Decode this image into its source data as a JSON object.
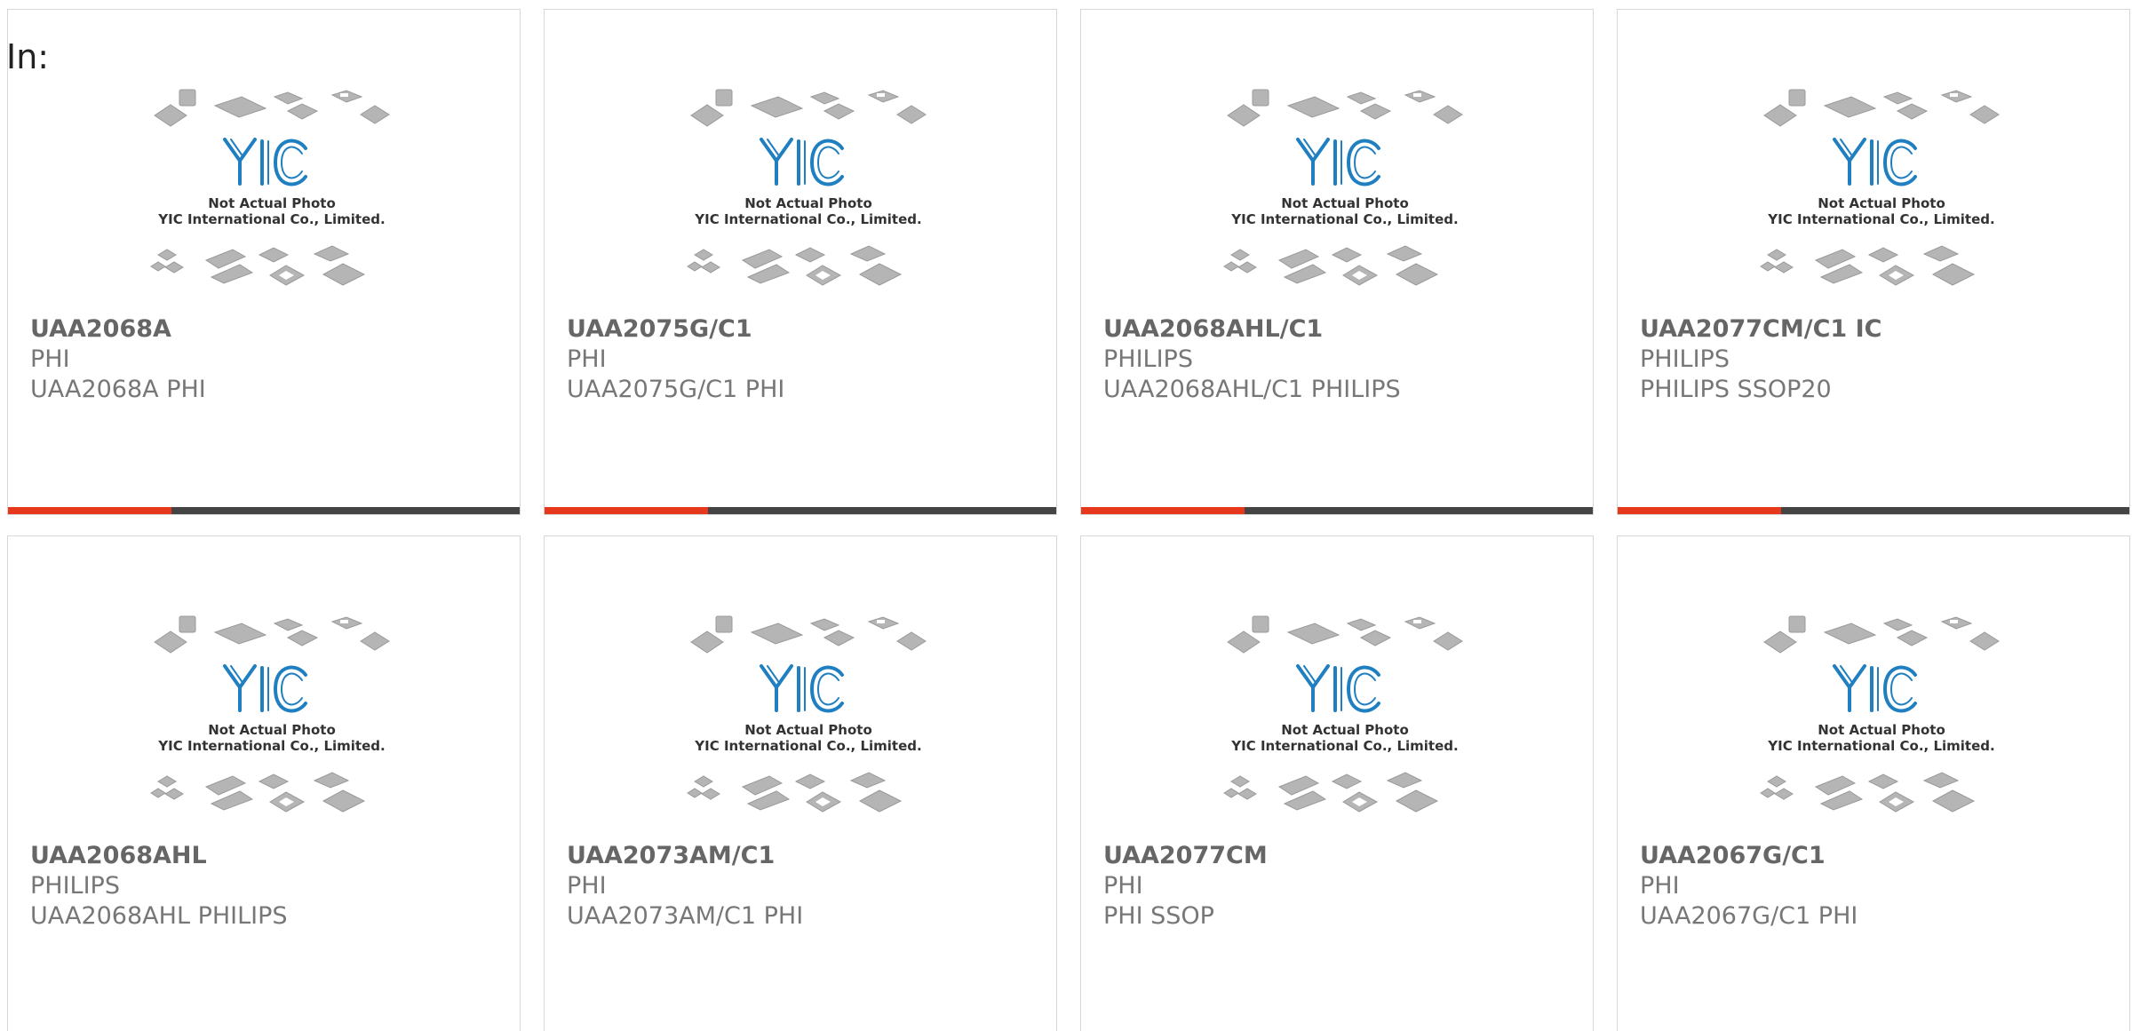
{
  "header": {
    "in_label": "In:"
  },
  "placeholder": {
    "line1": "Not Actual Photo",
    "line2": "YIC International Co., Limited.",
    "logo": "YIC"
  },
  "colors": {
    "accent": "#e8381b",
    "bar": "#444444",
    "logo_blue": "#1f7fc0"
  },
  "products": [
    {
      "part": "UAA2068A",
      "brand": "PHI",
      "desc": "UAA2068A PHI",
      "bar_accent_fraction": 0.32
    },
    {
      "part": "UAA2075G/C1",
      "brand": "PHI",
      "desc": "UAA2075G/C1 PHI",
      "bar_accent_fraction": 0.32
    },
    {
      "part": "UAA2068AHL/C1",
      "brand": "PHILIPS",
      "desc": "UAA2068AHL/C1 PHILIPS",
      "bar_accent_fraction": 0.32
    },
    {
      "part": "UAA2077CM/C1 IC",
      "brand": "PHILIPS",
      "desc": "PHILIPS SSOP20",
      "bar_accent_fraction": 0.32
    },
    {
      "part": "UAA2068AHL",
      "brand": "PHILIPS",
      "desc": "UAA2068AHL PHILIPS",
      "bar_accent_fraction": 0
    },
    {
      "part": "UAA2073AM/C1",
      "brand": "PHI",
      "desc": "UAA2073AM/C1 PHI",
      "bar_accent_fraction": 0
    },
    {
      "part": "UAA2077CM",
      "brand": "PHI",
      "desc": "PHI SSOP",
      "bar_accent_fraction": 0
    },
    {
      "part": "UAA2067G/C1",
      "brand": "PHI",
      "desc": "UAA2067G/C1 PHI",
      "bar_accent_fraction": 0
    }
  ]
}
